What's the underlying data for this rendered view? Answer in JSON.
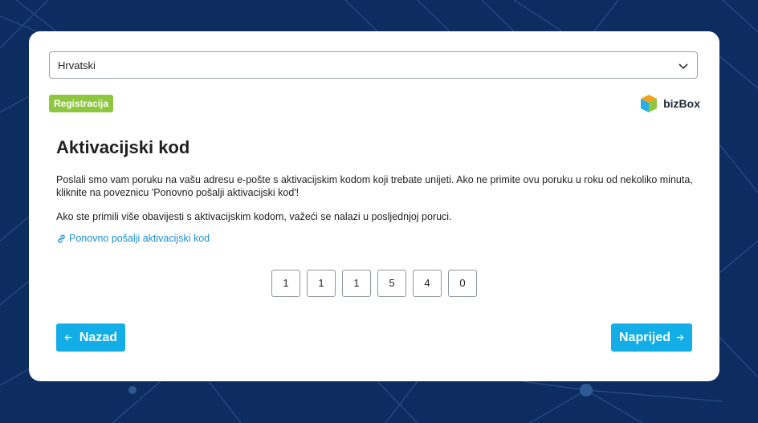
{
  "language_select": {
    "value": "Hrvatski"
  },
  "badge": {
    "label": "Registracija"
  },
  "brand": {
    "name": "bizBox"
  },
  "page": {
    "title": "Aktivacijski kod",
    "paragraph1": "Poslali smo vam poruku na vašu adresu e-pošte s aktivacijskim kodom koji trebate unijeti. Ako ne primite ovu poruku u roku od nekoliko minuta, kliknite na poveznicu 'Ponovno pošalji aktivacijski kod'!",
    "paragraph2": "Ako ste primili više obavijesti s aktivacijskim kodom, važeći se nalazi u posljednjoj poruci.",
    "resend_link": "Ponovno pošalji aktivacijski kod"
  },
  "code_digits": [
    "1",
    "1",
    "1",
    "5",
    "4",
    "0"
  ],
  "buttons": {
    "back": "Nazad",
    "next": "Naprijed"
  },
  "colors": {
    "background": "#0d2c5f",
    "accent": "#13aee8",
    "badge": "#8dc63f",
    "link": "#1e8fd6"
  }
}
